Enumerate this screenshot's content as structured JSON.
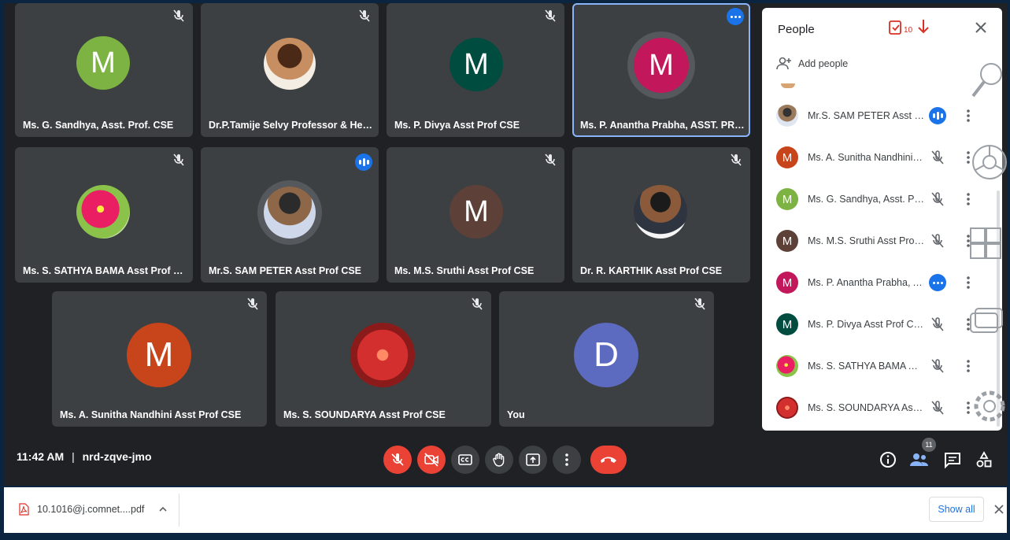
{
  "tiles": [
    {
      "name": "Ms. G. Sandhya, Asst. Prof. CSE",
      "initial": "M",
      "color": "#7cb342",
      "mic": "muted"
    },
    {
      "name": "Dr.P.Tamije Selvy Professor & Head ...",
      "initial": "",
      "color": "#9e6b3a",
      "mic": "muted"
    },
    {
      "name": "Ms. P. Divya Asst Prof CSE",
      "initial": "M",
      "color": "#004d40",
      "mic": "muted"
    },
    {
      "name": "Ms. P. Anantha Prabha, ASST. PROF",
      "initial": "M",
      "color": "#c2185b",
      "mic": "more"
    },
    {
      "name": "Ms. S. SATHYA BAMA Asst Prof CSE",
      "initial": "",
      "color": "#d81b60",
      "mic": "muted"
    },
    {
      "name": "Mr.S. SAM PETER Asst Prof CSE",
      "initial": "",
      "color": "#5c6bc0",
      "mic": "speaking"
    },
    {
      "name": "Ms. M.S. Sruthi Asst Prof CSE",
      "initial": "M",
      "color": "#5d4037",
      "mic": "muted"
    },
    {
      "name": "Dr. R. KARTHIK Asst Prof CSE",
      "initial": "",
      "color": "#6d4c41",
      "mic": "muted"
    },
    {
      "name": "Ms. A. Sunitha Nandhini Asst Prof CSE",
      "initial": "M",
      "color": "#c8441a",
      "mic": "muted"
    },
    {
      "name": "Ms. S. SOUNDARYA Asst Prof CSE",
      "initial": "",
      "color": "#c62828",
      "mic": "muted"
    },
    {
      "name": "You",
      "initial": "D",
      "color": "#5c6bc0",
      "mic": "muted"
    }
  ],
  "meeting": {
    "time": "11:42 AM",
    "code": "nrd-zqve-jmo",
    "separator": "|"
  },
  "participants_count": "11",
  "people": {
    "title": "People",
    "add_label": "Add people",
    "annotation_count": "10",
    "rows": [
      {
        "name": "Mr.S. SAM PETER Asst Pro...",
        "initial": "",
        "color": "#9fa8da",
        "status": "speaking"
      },
      {
        "name": "Ms. A. Sunitha Nandhini A...",
        "initial": "M",
        "color": "#c8441a",
        "status": "muted"
      },
      {
        "name": "Ms. G. Sandhya, Asst. Pro...",
        "initial": "M",
        "color": "#7cb342",
        "status": "muted"
      },
      {
        "name": "Ms. M.S. Sruthi Asst Prof ...",
        "initial": "M",
        "color": "#5d4037",
        "status": "muted"
      },
      {
        "name": "Ms. P. Anantha Prabha, A...",
        "initial": "M",
        "color": "#c2185b",
        "status": "more"
      },
      {
        "name": "Ms. P. Divya Asst Prof CSE",
        "initial": "M",
        "color": "#004d40",
        "status": "muted"
      },
      {
        "name": "Ms. S. SATHYA BAMA Ass...",
        "initial": "",
        "color": "#d81b60",
        "status": "muted"
      },
      {
        "name": "Ms. S. SOUNDARYA Asst ...",
        "initial": "",
        "color": "#c62828",
        "status": "muted"
      }
    ]
  },
  "download": {
    "filename": "10.1016@j.comnet....pdf",
    "show_all": "Show all"
  }
}
